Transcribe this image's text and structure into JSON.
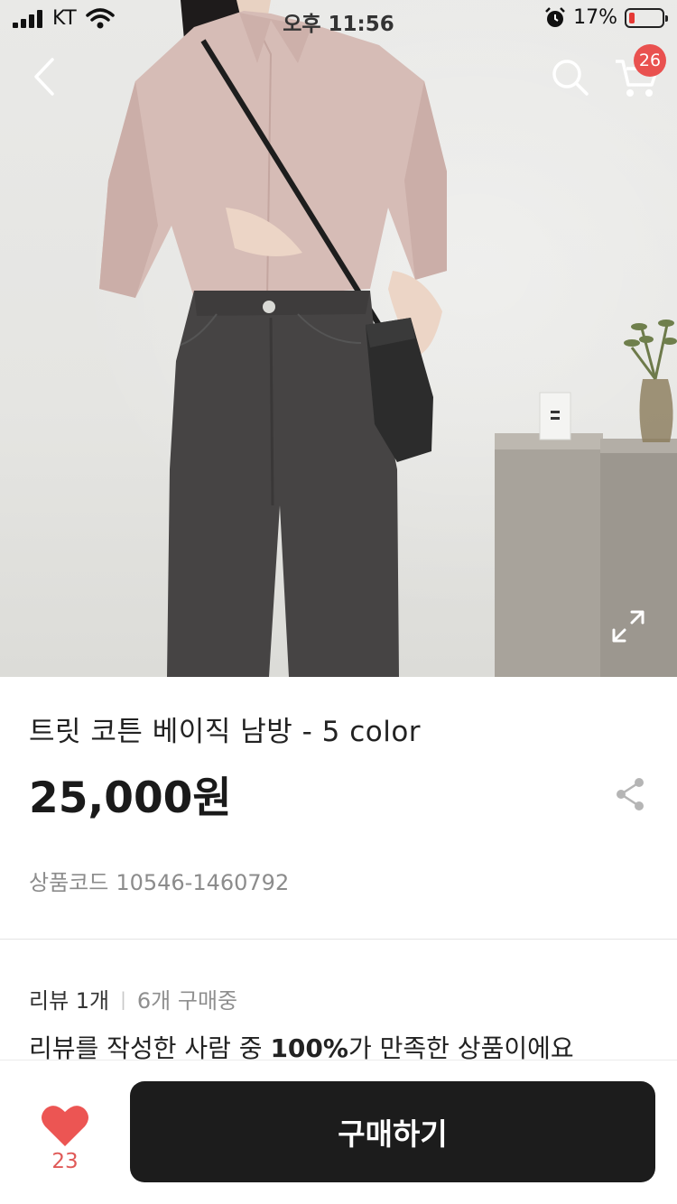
{
  "status_bar": {
    "carrier": "KT",
    "time": "오후 11:56",
    "battery_text": "17%",
    "battery_level": 0.17
  },
  "header": {
    "cart_badge": "26"
  },
  "product": {
    "title": "트릿 코튼 베이직 남방 - 5 color",
    "price": "25,000원",
    "code_label": "상품코드",
    "code_value": "10546-1460792"
  },
  "reviews": {
    "review_label": "리뷰 1개",
    "separator": "|",
    "buying_label": "6개 구매중",
    "satisfaction_prefix": "리뷰를 작성한 사람 중 ",
    "satisfaction_percent": "100%",
    "satisfaction_suffix": "가 만족한 상품이에요"
  },
  "bottom_bar": {
    "like_count": "23",
    "buy_label": "구매하기"
  },
  "colors": {
    "badge": "#e9514f",
    "heart": "#ec5553",
    "buy_button": "#1c1c1c",
    "battery_low": "#e53935"
  },
  "icons": [
    "signal-icon",
    "wifi-icon",
    "alarm-icon",
    "battery-icon",
    "back-chevron-icon",
    "search-icon",
    "cart-icon",
    "expand-icon",
    "share-icon",
    "heart-icon"
  ]
}
